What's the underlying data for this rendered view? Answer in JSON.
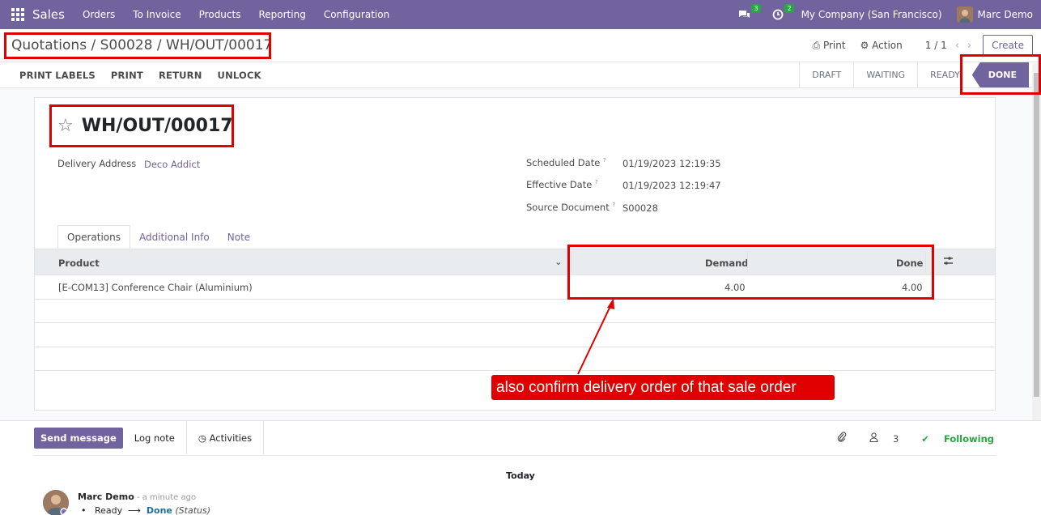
{
  "navbar": {
    "app_name": "Sales",
    "menus": [
      "Orders",
      "To Invoice",
      "Products",
      "Reporting",
      "Configuration"
    ],
    "messages_badge": "3",
    "activities_badge": "2",
    "company": "My Company (San Francisco)",
    "user": "Marc Demo"
  },
  "breadcrumb": {
    "quotations": "Quotations",
    "order": "S00028",
    "current": "WH/OUT/00017",
    "sep": "/"
  },
  "toolbar": {
    "print": "Print",
    "action": "Action",
    "pager": "1 / 1",
    "create": "Create"
  },
  "actions": [
    "PRINT LABELS",
    "PRINT",
    "RETURN",
    "UNLOCK"
  ],
  "stages": [
    "DRAFT",
    "WAITING",
    "READY",
    "DONE"
  ],
  "record": {
    "title": "WH/OUT/00017",
    "delivery_address_label": "Delivery Address",
    "delivery_address": "Deco Addict",
    "scheduled_date_label": "Scheduled Date",
    "scheduled_date": "01/19/2023 12:19:35",
    "effective_date_label": "Effective Date",
    "effective_date": "01/19/2023 12:19:47",
    "source_document_label": "Source Document",
    "source_document": "S00028",
    "help_mark": "?"
  },
  "tabs": [
    "Operations",
    "Additional Info",
    "Note"
  ],
  "table": {
    "headers": {
      "product": "Product",
      "demand": "Demand",
      "done": "Done"
    },
    "rows": [
      {
        "product": "[E-COM13] Conference Chair (Aluminium)",
        "demand": "4.00",
        "done": "4.00"
      }
    ]
  },
  "chatter": {
    "send_message": "Send message",
    "log_note": "Log note",
    "activities": "Activities",
    "followers_count": "3",
    "following": "Following",
    "today": "Today",
    "author": "Marc Demo",
    "time": " - a minute ago",
    "from_state": "Ready",
    "to_state": "Done",
    "field": "(Status)"
  },
  "annotation": {
    "callout": "also  confirm delivery order of that sale order",
    "color": "#e00000"
  },
  "colors": {
    "brand": "#71639e",
    "following": "#28a745"
  }
}
